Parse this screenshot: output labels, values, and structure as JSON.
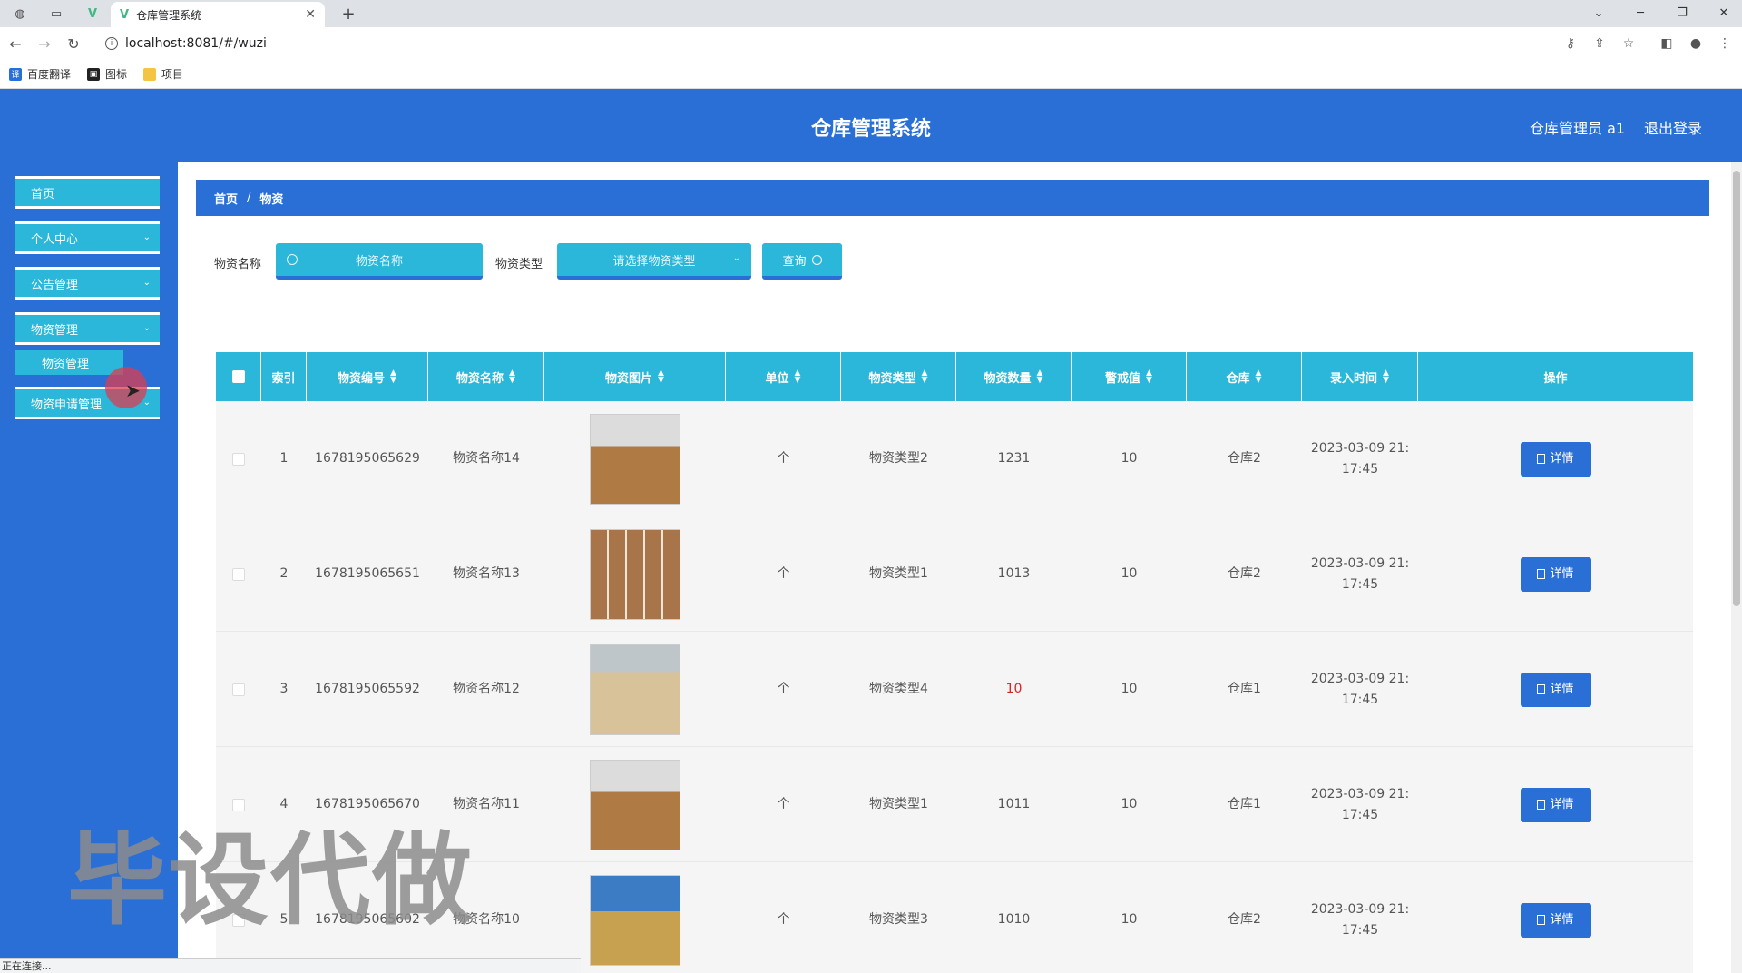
{
  "browser": {
    "tab_title": "仓库管理系统",
    "url": "localhost:8081/#/wuzi",
    "bookmarks": [
      "百度翻译",
      "图标",
      "项目"
    ],
    "status_text": "正在连接..."
  },
  "header": {
    "title": "仓库管理系统",
    "user": "仓库管理员 a1",
    "logout": "退出登录"
  },
  "sidebar": {
    "items": [
      {
        "label": "首页"
      },
      {
        "label": "个人中心"
      },
      {
        "label": "公告管理"
      },
      {
        "label": "物资管理"
      },
      {
        "label": "物资申请管理"
      }
    ],
    "active_sub": "物资管理"
  },
  "breadcrumb": {
    "home": "首页",
    "current": "物资"
  },
  "search": {
    "name_label": "物资名称",
    "name_placeholder": "物资名称",
    "type_label": "物资类型",
    "type_placeholder": "请选择物资类型",
    "query_label": "查询"
  },
  "table": {
    "headers": [
      "索引",
      "物资编号",
      "物资名称",
      "物资图片",
      "单位",
      "物资类型",
      "物资数量",
      "警戒值",
      "仓库",
      "录入时间",
      "操作"
    ],
    "detail_label": "详情",
    "rows": [
      {
        "index": "1",
        "code": "1678195065629",
        "name": "物资名称14",
        "unit": "个",
        "type": "物资类型2",
        "qty": "1231",
        "warn": "10",
        "warehouse": "仓库2",
        "time1": "2023-03-09 21:",
        "time2": "17:45"
      },
      {
        "index": "2",
        "code": "1678195065651",
        "name": "物资名称13",
        "unit": "个",
        "type": "物资类型1",
        "qty": "1013",
        "warn": "10",
        "warehouse": "仓库2",
        "time1": "2023-03-09 21:",
        "time2": "17:45"
      },
      {
        "index": "3",
        "code": "1678195065592",
        "name": "物资名称12",
        "unit": "个",
        "type": "物资类型4",
        "qty": "10",
        "warn": "10",
        "warehouse": "仓库1",
        "time1": "2023-03-09 21:",
        "time2": "17:45"
      },
      {
        "index": "4",
        "code": "1678195065670",
        "name": "物资名称11",
        "unit": "个",
        "type": "物资类型1",
        "qty": "1011",
        "warn": "10",
        "warehouse": "仓库1",
        "time1": "2023-03-09 21:",
        "time2": "17:45"
      },
      {
        "index": "5",
        "code": "1678195065602",
        "name": "物资名称10",
        "unit": "个",
        "type": "物资类型3",
        "qty": "1010",
        "warn": "10",
        "warehouse": "仓库2",
        "time1": "2023-03-09 21:",
        "time2": "17:45"
      }
    ]
  },
  "watermark": "毕设代做",
  "colors": {
    "primary": "#2a6fd6",
    "accent": "#2bb7d9",
    "warning": "#e02020"
  }
}
